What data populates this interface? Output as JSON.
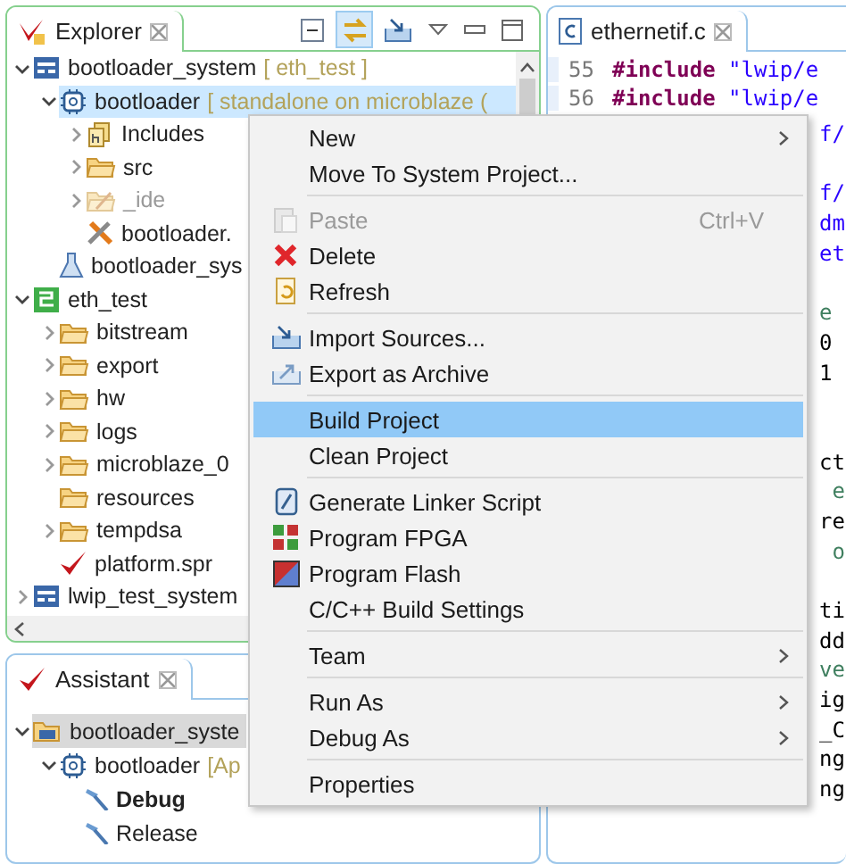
{
  "explorer": {
    "tab": {
      "label": "Explorer"
    },
    "toolbar": [
      {
        "kind": "collapse",
        "on": false
      },
      {
        "kind": "link",
        "on": true
      },
      {
        "kind": "import",
        "on": false
      }
    ],
    "tree": [
      {
        "label": "bootloader_system",
        "note": "[ eth_test ]",
        "kind": "system",
        "expanded": true,
        "selected": false,
        "disabled": false,
        "children": [
          {
            "label": "bootloader",
            "note": "[ standalone on microblaze (",
            "kind": "app",
            "expanded": true,
            "selected": true,
            "disabled": false,
            "children": [
              {
                "label": "Includes",
                "kind": "includes",
                "expanded": false,
                "selected": false,
                "disabled": false
              },
              {
                "label": "src",
                "kind": "folder",
                "expanded": false,
                "selected": false,
                "disabled": false
              },
              {
                "label": "_ide",
                "kind": "folder-edit",
                "expanded": false,
                "selected": false,
                "disabled": true
              },
              {
                "label": "bootloader.",
                "kind": "tools",
                "selected": false,
                "disabled": false
              }
            ]
          },
          {
            "label": "bootloader_sys",
            "kind": "launch",
            "selected": false,
            "disabled": false
          }
        ]
      },
      {
        "label": "eth_test",
        "kind": "platform",
        "expanded": true,
        "selected": false,
        "disabled": false,
        "children": [
          {
            "label": "bitstream",
            "kind": "folder",
            "expanded": false,
            "selected": false,
            "disabled": false
          },
          {
            "label": "export",
            "kind": "folder",
            "expanded": false,
            "selected": false,
            "disabled": false
          },
          {
            "label": "hw",
            "kind": "folder",
            "expanded": false,
            "selected": false,
            "disabled": false
          },
          {
            "label": "logs",
            "kind": "folder",
            "expanded": false,
            "selected": false,
            "disabled": false
          },
          {
            "label": "microblaze_0",
            "kind": "folder",
            "expanded": false,
            "selected": false,
            "disabled": false
          },
          {
            "label": "resources",
            "kind": "folder",
            "selected": false,
            "disabled": false
          },
          {
            "label": "tempdsa",
            "kind": "folder",
            "expanded": false,
            "selected": false,
            "disabled": false
          },
          {
            "label": "platform.spr",
            "kind": "spr",
            "selected": false,
            "disabled": false
          }
        ]
      },
      {
        "label": "lwip_test_system",
        "kind": "system",
        "expanded": false,
        "selected": false,
        "disabled": false
      }
    ]
  },
  "assistant": {
    "tab": {
      "label": "Assistant"
    },
    "tree": [
      {
        "label": "bootloader_syste",
        "kind": "system-folder",
        "expanded": true,
        "selected": true,
        "active": false,
        "children": [
          {
            "label": "bootloader",
            "note": "[Ap",
            "kind": "app",
            "expanded": true,
            "selected": false,
            "active": false,
            "children": [
              {
                "label": "Debug",
                "kind": "config",
                "selected": false,
                "active": true
              },
              {
                "label": "Release",
                "kind": "config",
                "selected": false,
                "active": false
              }
            ]
          }
        ]
      }
    ]
  },
  "editor": {
    "tab": {
      "label": "ethernetif.c"
    },
    "lines": [
      {
        "number": "55",
        "keyword": "#include",
        "string": "\"lwip/e"
      },
      {
        "number": "56",
        "keyword": "#include",
        "string": "\"lwip/e"
      }
    ],
    "fragments": [
      {
        "kind": "string",
        "text": "f/"
      },
      {
        "kind": "blank"
      },
      {
        "kind": "string",
        "text": "f/"
      },
      {
        "kind": "string",
        "text": "dm"
      },
      {
        "kind": "string",
        "text": "et"
      },
      {
        "kind": "blank"
      },
      {
        "kind": "comment",
        "text": "e"
      },
      {
        "kind": "plain",
        "text": "0"
      },
      {
        "kind": "plain",
        "text": "1"
      },
      {
        "kind": "blank"
      },
      {
        "kind": "blank"
      },
      {
        "kind": "plain",
        "text": "ct"
      },
      {
        "kind": "comment",
        "text": " e"
      },
      {
        "kind": "plain",
        "text": "re"
      },
      {
        "kind": "comment",
        "text": " o"
      },
      {
        "kind": "blank"
      },
      {
        "kind": "plain",
        "text": "ti"
      },
      {
        "kind": "plain",
        "text": "dd"
      },
      {
        "kind": "comment",
        "text": "ve"
      },
      {
        "kind": "plain",
        "text": "ig"
      },
      {
        "kind": "plain",
        "text": "_C"
      },
      {
        "kind": "plain",
        "text": "ng"
      },
      {
        "kind": "plain",
        "text": "ng"
      }
    ]
  },
  "context_menu": [
    {
      "kind": "plain",
      "label": "New",
      "submenu": true,
      "disabled": false,
      "selected": false
    },
    {
      "kind": "plain",
      "label": "Move To System Project...",
      "submenu": false,
      "disabled": false,
      "selected": false
    },
    {
      "kind": "separator"
    },
    {
      "kind": "paste",
      "label": "Paste",
      "shortcut": "Ctrl+V",
      "submenu": false,
      "disabled": true,
      "selected": false
    },
    {
      "kind": "delete",
      "label": "Delete",
      "submenu": false,
      "disabled": false,
      "selected": false
    },
    {
      "kind": "refresh",
      "label": "Refresh",
      "submenu": false,
      "disabled": false,
      "selected": false
    },
    {
      "kind": "separator"
    },
    {
      "kind": "import",
      "label": "Import Sources...",
      "submenu": false,
      "disabled": false,
      "selected": false
    },
    {
      "kind": "export",
      "label": "Export as Archive",
      "submenu": false,
      "disabled": false,
      "selected": false
    },
    {
      "kind": "separator"
    },
    {
      "kind": "plain",
      "label": "Build Project",
      "submenu": false,
      "disabled": false,
      "selected": true
    },
    {
      "kind": "plain",
      "label": "Clean Project",
      "submenu": false,
      "disabled": false,
      "selected": false
    },
    {
      "kind": "separator"
    },
    {
      "kind": "linker",
      "label": "Generate Linker Script",
      "submenu": false,
      "disabled": false,
      "selected": false
    },
    {
      "kind": "fpga",
      "label": "Program FPGA",
      "submenu": false,
      "disabled": false,
      "selected": false
    },
    {
      "kind": "flash",
      "label": "Program Flash",
      "submenu": false,
      "disabled": false,
      "selected": false
    },
    {
      "kind": "plain",
      "label": "C/C++ Build Settings",
      "submenu": false,
      "disabled": false,
      "selected": false
    },
    {
      "kind": "separator"
    },
    {
      "kind": "plain",
      "label": "Team",
      "submenu": true,
      "disabled": false,
      "selected": false
    },
    {
      "kind": "separator"
    },
    {
      "kind": "plain",
      "label": "Run As",
      "submenu": true,
      "disabled": false,
      "selected": false
    },
    {
      "kind": "plain",
      "label": "Debug As",
      "submenu": true,
      "disabled": false,
      "selected": false
    },
    {
      "kind": "separator"
    },
    {
      "kind": "plain",
      "label": "Properties",
      "submenu": false,
      "disabled": false,
      "selected": false
    }
  ]
}
